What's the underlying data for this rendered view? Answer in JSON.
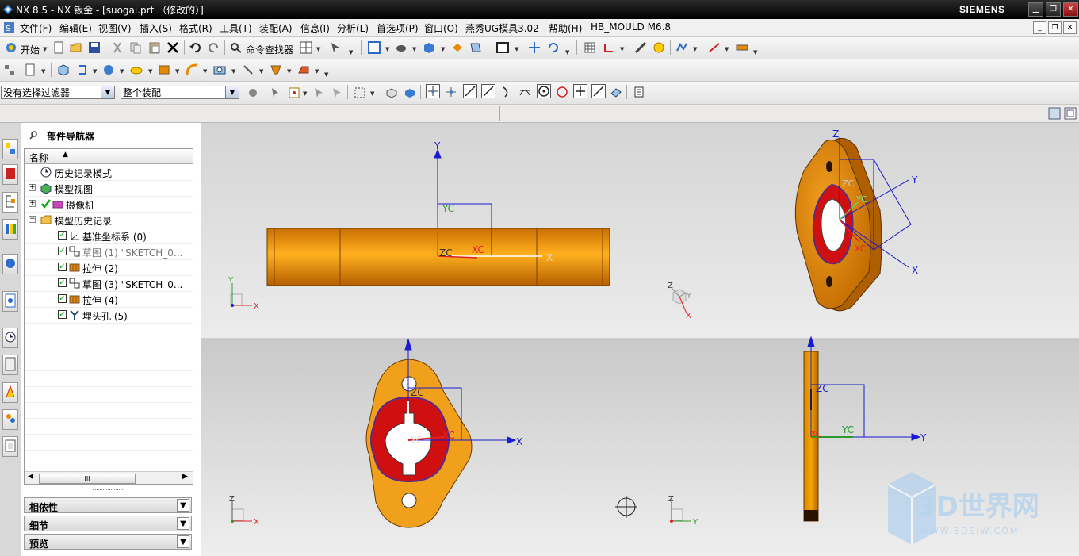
{
  "titlebar": {
    "title": "NX 8.5 - NX 钣金 - [suogai.prt （修改的）]",
    "brand": "SIEMENS",
    "minimize": "▁",
    "restore": "❐",
    "close": "✕"
  },
  "menubar": {
    "items": [
      "文件(F)",
      "编辑(E)",
      "视图(V)",
      "插入(S)",
      "格式(R)",
      "工具(T)",
      "装配(A)",
      "信息(I)",
      "分析(L)",
      "首选项(P)",
      "窗口(O)",
      "燕秀UG模具3.02",
      "帮助(H)",
      "HB_MOULD M6.8"
    ],
    "mdi": [
      "_",
      "❐",
      "✕"
    ]
  },
  "toolbar1": {
    "start_label": "开始",
    "command_finder_label": "命令查找器"
  },
  "selection_bar": {
    "filter_value": "没有选择过滤器",
    "scope_value": "整个装配"
  },
  "navigator": {
    "title": "部件导航器",
    "column_name": "名称",
    "column_sort": "▲",
    "items": [
      {
        "label": "历史记录模式",
        "icon": "clock-icon"
      },
      {
        "label": "模型视图",
        "icon": "views-icon"
      },
      {
        "label": "摄像机",
        "icon": "camera-icon"
      },
      {
        "label": "模型历史记录",
        "icon": "folder-icon"
      },
      {
        "label": "基准坐标系 (0)",
        "icon": "datum-csys-icon"
      },
      {
        "label": "草图 (1) \"SKETCH_0...",
        "icon": "sketch-icon"
      },
      {
        "label": "拉伸 (2)",
        "icon": "extrude-icon"
      },
      {
        "label": "草图 (3) \"SKETCH_0...",
        "icon": "sketch-icon"
      },
      {
        "label": "拉伸 (4)",
        "icon": "extrude-icon"
      },
      {
        "label": "埋头孔 (5)",
        "icon": "countersink-icon"
      }
    ],
    "scroll_grip": "III",
    "panels": [
      "相依性",
      "细节",
      "预览"
    ]
  },
  "viewport": {
    "axis_labels": {
      "x": "X",
      "y": "Y",
      "z": "Z",
      "xc": "XC",
      "yc": "YC",
      "zc": "ZC"
    },
    "watermark_title": "3D世界网",
    "watermark_url": "WWW.3DSJW.COM",
    "colors": {
      "part_orange": "#e88a00",
      "part_red": "#d01010",
      "axis_blue": "#1a1ad0",
      "background_top": "#dcdcdc",
      "background_bottom": "#e6e6e6"
    }
  }
}
